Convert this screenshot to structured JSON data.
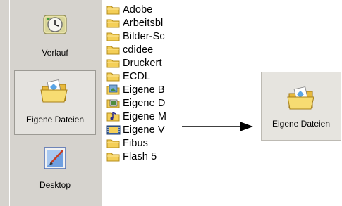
{
  "places_bar": {
    "items": [
      {
        "label": "Verlauf",
        "icon": "clock-history-icon"
      },
      {
        "label": "Eigene Dateien",
        "icon": "open-folder-documents-icon"
      },
      {
        "label": "Desktop",
        "icon": "desktop-icon"
      }
    ]
  },
  "file_list": {
    "items": [
      {
        "name": "Adobe",
        "icon": "folder-icon"
      },
      {
        "name": "Arbeitsbl",
        "icon": "folder-icon"
      },
      {
        "name": "Bilder-Sc",
        "icon": "folder-icon"
      },
      {
        "name": "cdidee",
        "icon": "folder-icon"
      },
      {
        "name": "Druckert",
        "icon": "folder-icon"
      },
      {
        "name": "ECDL",
        "icon": "folder-icon"
      },
      {
        "name": "Eigene B",
        "icon": "pictures-folder-icon"
      },
      {
        "name": "Eigene D",
        "icon": "documents-folder-icon"
      },
      {
        "name": "Eigene M",
        "icon": "music-folder-icon"
      },
      {
        "name": "Eigene V",
        "icon": "videos-folder-icon"
      },
      {
        "name": "Fibus",
        "icon": "folder-icon"
      },
      {
        "name": "Flash 5",
        "icon": "folder-icon"
      }
    ]
  },
  "callout": {
    "label": "Eigene Dateien",
    "icon": "open-folder-documents-icon"
  },
  "colors": {
    "folder": "#f7d35a",
    "folder_dark": "#c79a1b",
    "places_bg": "#d6d3ce"
  }
}
